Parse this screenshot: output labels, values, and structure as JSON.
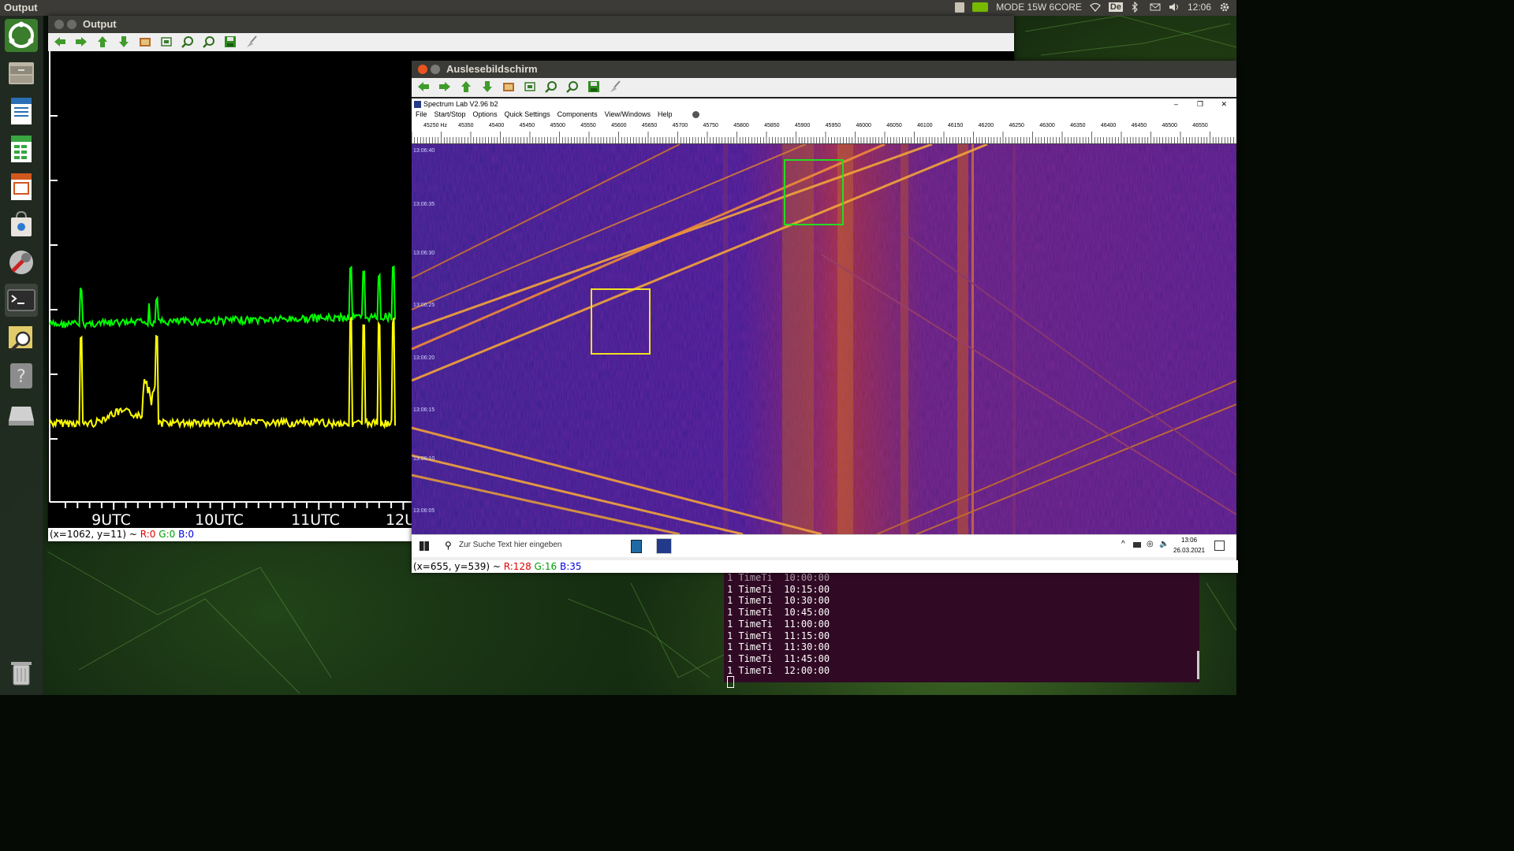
{
  "top_panel": {
    "app_title": "Output",
    "mode": "MODE 15W 6CORE",
    "keyboard_layout": "De",
    "clock": "12:06"
  },
  "output_window": {
    "title": "Output",
    "x_ticks": [
      "9UTC",
      "10UTC",
      "11UTC",
      "12U"
    ],
    "status": {
      "coords": "(x=1062, y=11) ~ ",
      "r": "R:0",
      "g": "G:0",
      "b": "B:0"
    },
    "colors": {
      "green_trace": "#00ff00",
      "yellow_trace": "#ffff00",
      "background": "#000000"
    }
  },
  "readout_window": {
    "title": "Auslesebildschirm",
    "status": {
      "coords": "(x=655, y=539) ~ ",
      "r": "R:128",
      "g": "G:16",
      "b": "B:35"
    },
    "spectrum_lab": {
      "title": "Spectrum Lab V2.96 b2",
      "menu": [
        "File",
        "Start/Stop",
        "Options",
        "Quick Settings",
        "Components",
        "View/Windows",
        "Help"
      ],
      "freq_labels": [
        "45250 Hz",
        "45350",
        "45400",
        "45450",
        "45500",
        "45550",
        "45600",
        "45650",
        "45700",
        "45750",
        "45800",
        "45850",
        "45900",
        "45950",
        "46000",
        "46050",
        "46100",
        "46150",
        "46200",
        "46250",
        "46300",
        "46350",
        "46400",
        "46450",
        "46500",
        "46550"
      ],
      "time_labels": [
        "13:06:40",
        "13:06:35",
        "13:06:30",
        "13:06:25",
        "13:06:20",
        "13:06:15",
        "13:06:10",
        "13:06:05"
      ],
      "taskbar": {
        "search_placeholder": "Zur Suche Text hier eingeben",
        "time": "13:06",
        "date": "26.03.2021"
      }
    }
  },
  "terminal": {
    "lines": [
      "1 TimeTi  10:00:00",
      "1 TimeTi  10:15:00",
      "1 TimeTi  10:30:00",
      "1 TimeTi  10:45:00",
      "1 TimeTi  11:00:00",
      "1 TimeTi  11:15:00",
      "1 TimeTi  11:30:00",
      "1 TimeTi  11:45:00",
      "1 TimeTi  12:00:00"
    ]
  }
}
